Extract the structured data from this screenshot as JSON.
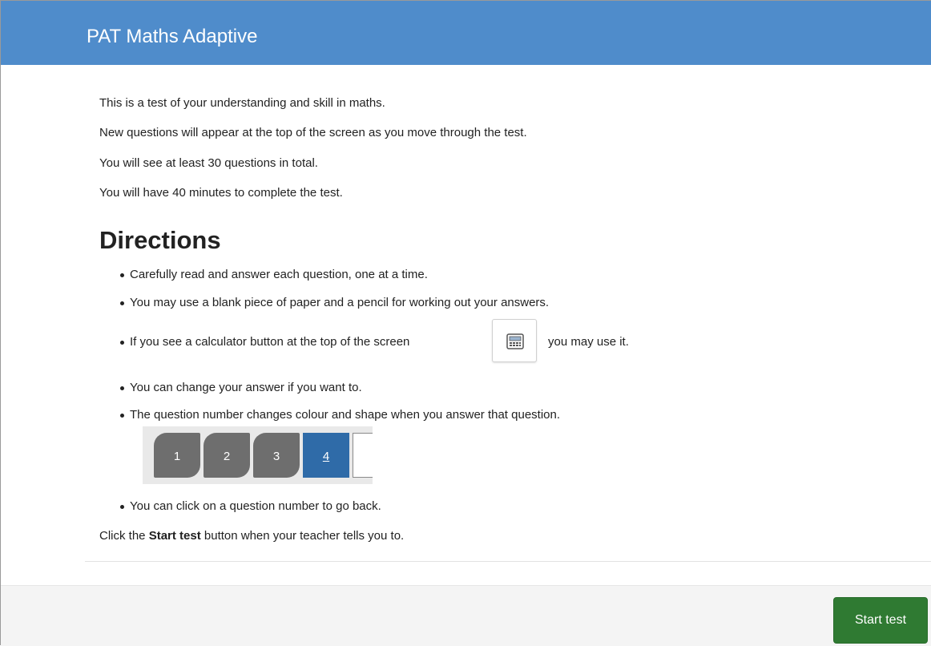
{
  "app": {
    "title": "PAT Maths Adaptive"
  },
  "intro": {
    "lines": [
      "This is a test of your understanding and skill in maths.",
      "New questions will appear at the top of the screen as you move through the test.",
      "You will see at least 30 questions in total.",
      "You will have 40 minutes to complete the test."
    ]
  },
  "directions": {
    "heading": "Directions",
    "items": [
      "Carefully read and answer each question, one at a time.",
      "You may use a blank piece of paper and a pencil for working out your answers.",
      "If you see a calculator button at the top of the screen",
      "You can change your answer if you want to.",
      "The question number changes colour and shape when you answer that question.",
      "You can click on a question number to go back."
    ],
    "calculator_suffix": "you may use it.",
    "calculator_icon": "calculator-icon"
  },
  "question_nav": {
    "buttons": [
      {
        "label": "1",
        "state": "answered"
      },
      {
        "label": "2",
        "state": "answered"
      },
      {
        "label": "3",
        "state": "answered"
      },
      {
        "label": "4",
        "state": "current"
      },
      {
        "label": "",
        "state": "unanswered"
      }
    ]
  },
  "footer_text": {
    "prefix": "Click the ",
    "bold": "Start test",
    "suffix": " button when your teacher tells you to."
  },
  "actions": {
    "start_label": "Start test"
  },
  "colors": {
    "header": "#4f8ccb",
    "answered": "#6e6e6e",
    "current": "#2f6ba8",
    "start_button": "#2f7a32"
  }
}
